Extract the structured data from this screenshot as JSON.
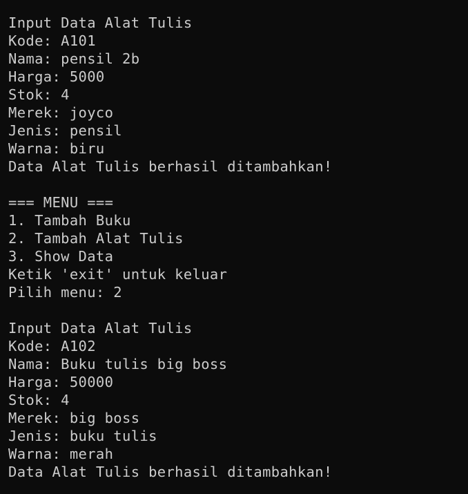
{
  "terminal": {
    "lines": [
      "Input Data Alat Tulis",
      "Kode: A101",
      "Nama: pensil 2b",
      "Harga: 5000",
      "Stok: 4",
      "Merek: joyco",
      "Jenis: pensil",
      "Warna: biru",
      "Data Alat Tulis berhasil ditambahkan!",
      "",
      "=== MENU ===",
      "1. Tambah Buku",
      "2. Tambah Alat Tulis",
      "3. Show Data",
      "Ketik 'exit' untuk keluar",
      "Pilih menu: 2",
      "",
      "Input Data Alat Tulis",
      "Kode: A102",
      "Nama: Buku tulis big boss",
      "Harga: 50000",
      "Stok: 4",
      "Merek: big boss",
      "Jenis: buku tulis",
      "Warna: merah",
      "Data Alat Tulis berhasil ditambahkan!"
    ]
  },
  "colors": {
    "background": "#0c0c0c",
    "text": "#cccccc"
  }
}
